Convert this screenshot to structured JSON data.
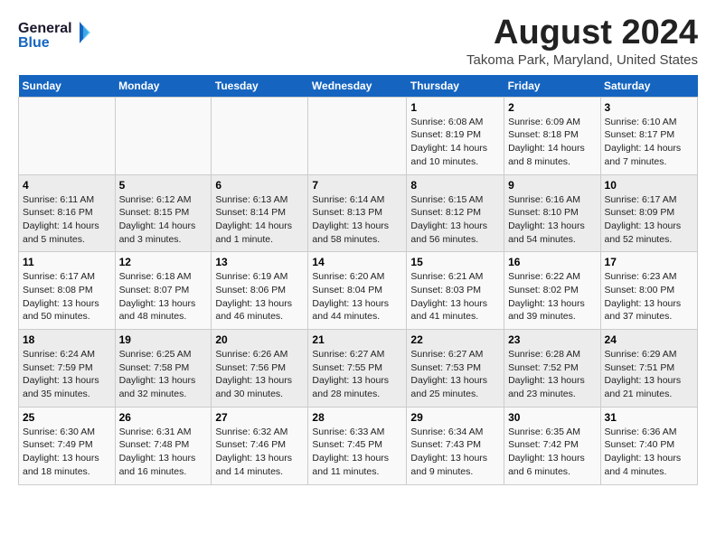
{
  "header": {
    "logo_line1": "General",
    "logo_line2": "Blue",
    "month_year": "August 2024",
    "location": "Takoma Park, Maryland, United States"
  },
  "weekdays": [
    "Sunday",
    "Monday",
    "Tuesday",
    "Wednesday",
    "Thursday",
    "Friday",
    "Saturday"
  ],
  "weeks": [
    [
      {
        "day": "",
        "info": ""
      },
      {
        "day": "",
        "info": ""
      },
      {
        "day": "",
        "info": ""
      },
      {
        "day": "",
        "info": ""
      },
      {
        "day": "1",
        "info": "Sunrise: 6:08 AM\nSunset: 8:19 PM\nDaylight: 14 hours\nand 10 minutes."
      },
      {
        "day": "2",
        "info": "Sunrise: 6:09 AM\nSunset: 8:18 PM\nDaylight: 14 hours\nand 8 minutes."
      },
      {
        "day": "3",
        "info": "Sunrise: 6:10 AM\nSunset: 8:17 PM\nDaylight: 14 hours\nand 7 minutes."
      }
    ],
    [
      {
        "day": "4",
        "info": "Sunrise: 6:11 AM\nSunset: 8:16 PM\nDaylight: 14 hours\nand 5 minutes."
      },
      {
        "day": "5",
        "info": "Sunrise: 6:12 AM\nSunset: 8:15 PM\nDaylight: 14 hours\nand 3 minutes."
      },
      {
        "day": "6",
        "info": "Sunrise: 6:13 AM\nSunset: 8:14 PM\nDaylight: 14 hours\nand 1 minute."
      },
      {
        "day": "7",
        "info": "Sunrise: 6:14 AM\nSunset: 8:13 PM\nDaylight: 13 hours\nand 58 minutes."
      },
      {
        "day": "8",
        "info": "Sunrise: 6:15 AM\nSunset: 8:12 PM\nDaylight: 13 hours\nand 56 minutes."
      },
      {
        "day": "9",
        "info": "Sunrise: 6:16 AM\nSunset: 8:10 PM\nDaylight: 13 hours\nand 54 minutes."
      },
      {
        "day": "10",
        "info": "Sunrise: 6:17 AM\nSunset: 8:09 PM\nDaylight: 13 hours\nand 52 minutes."
      }
    ],
    [
      {
        "day": "11",
        "info": "Sunrise: 6:17 AM\nSunset: 8:08 PM\nDaylight: 13 hours\nand 50 minutes."
      },
      {
        "day": "12",
        "info": "Sunrise: 6:18 AM\nSunset: 8:07 PM\nDaylight: 13 hours\nand 48 minutes."
      },
      {
        "day": "13",
        "info": "Sunrise: 6:19 AM\nSunset: 8:06 PM\nDaylight: 13 hours\nand 46 minutes."
      },
      {
        "day": "14",
        "info": "Sunrise: 6:20 AM\nSunset: 8:04 PM\nDaylight: 13 hours\nand 44 minutes."
      },
      {
        "day": "15",
        "info": "Sunrise: 6:21 AM\nSunset: 8:03 PM\nDaylight: 13 hours\nand 41 minutes."
      },
      {
        "day": "16",
        "info": "Sunrise: 6:22 AM\nSunset: 8:02 PM\nDaylight: 13 hours\nand 39 minutes."
      },
      {
        "day": "17",
        "info": "Sunrise: 6:23 AM\nSunset: 8:00 PM\nDaylight: 13 hours\nand 37 minutes."
      }
    ],
    [
      {
        "day": "18",
        "info": "Sunrise: 6:24 AM\nSunset: 7:59 PM\nDaylight: 13 hours\nand 35 minutes."
      },
      {
        "day": "19",
        "info": "Sunrise: 6:25 AM\nSunset: 7:58 PM\nDaylight: 13 hours\nand 32 minutes."
      },
      {
        "day": "20",
        "info": "Sunrise: 6:26 AM\nSunset: 7:56 PM\nDaylight: 13 hours\nand 30 minutes."
      },
      {
        "day": "21",
        "info": "Sunrise: 6:27 AM\nSunset: 7:55 PM\nDaylight: 13 hours\nand 28 minutes."
      },
      {
        "day": "22",
        "info": "Sunrise: 6:27 AM\nSunset: 7:53 PM\nDaylight: 13 hours\nand 25 minutes."
      },
      {
        "day": "23",
        "info": "Sunrise: 6:28 AM\nSunset: 7:52 PM\nDaylight: 13 hours\nand 23 minutes."
      },
      {
        "day": "24",
        "info": "Sunrise: 6:29 AM\nSunset: 7:51 PM\nDaylight: 13 hours\nand 21 minutes."
      }
    ],
    [
      {
        "day": "25",
        "info": "Sunrise: 6:30 AM\nSunset: 7:49 PM\nDaylight: 13 hours\nand 18 minutes."
      },
      {
        "day": "26",
        "info": "Sunrise: 6:31 AM\nSunset: 7:48 PM\nDaylight: 13 hours\nand 16 minutes."
      },
      {
        "day": "27",
        "info": "Sunrise: 6:32 AM\nSunset: 7:46 PM\nDaylight: 13 hours\nand 14 minutes."
      },
      {
        "day": "28",
        "info": "Sunrise: 6:33 AM\nSunset: 7:45 PM\nDaylight: 13 hours\nand 11 minutes."
      },
      {
        "day": "29",
        "info": "Sunrise: 6:34 AM\nSunset: 7:43 PM\nDaylight: 13 hours\nand 9 minutes."
      },
      {
        "day": "30",
        "info": "Sunrise: 6:35 AM\nSunset: 7:42 PM\nDaylight: 13 hours\nand 6 minutes."
      },
      {
        "day": "31",
        "info": "Sunrise: 6:36 AM\nSunset: 7:40 PM\nDaylight: 13 hours\nand 4 minutes."
      }
    ]
  ]
}
